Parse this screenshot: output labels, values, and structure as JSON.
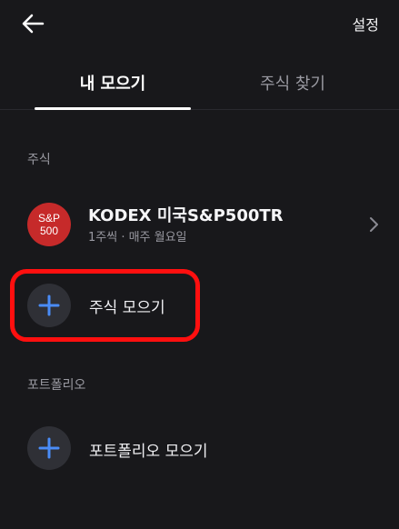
{
  "header": {
    "back_icon": "arrow-left-icon",
    "settings_label": "설정"
  },
  "tabs": [
    {
      "label": "내 모으기",
      "active": true
    },
    {
      "label": "주식 찾기",
      "active": false
    }
  ],
  "stocks_section": {
    "label": "주식",
    "items": [
      {
        "logo_line1": "S&P",
        "logo_line2": "500",
        "name": "KODEX 미국S&P500TR",
        "schedule": "1주씩 · 매주 월요일"
      }
    ],
    "add_label": "주식 모으기"
  },
  "portfolio_section": {
    "label": "포트폴리오",
    "add_label": "포트폴리오 모으기"
  },
  "colors": {
    "background": "#18181b",
    "accent_blue": "#4a8cf7",
    "logo_red": "#c62a2a",
    "highlight_red": "#ff0f0f"
  }
}
